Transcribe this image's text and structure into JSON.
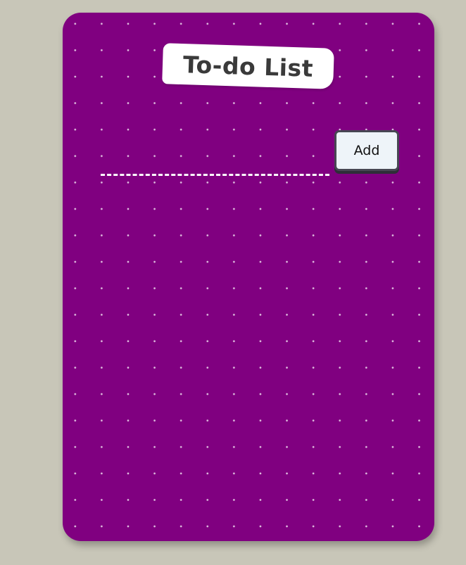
{
  "app": {
    "title": "To-do List"
  },
  "input": {
    "value": "",
    "placeholder": ""
  },
  "add_button": {
    "label": "Add"
  },
  "todo_items": [],
  "colors": {
    "page_background": "#c8c6b8",
    "card_background": "#800080",
    "dot_pattern": "#ffffff",
    "title_card_background": "#ffffff",
    "title_text": "#3a3a3a",
    "button_background": "#eef4f9",
    "button_border": "#474753"
  }
}
